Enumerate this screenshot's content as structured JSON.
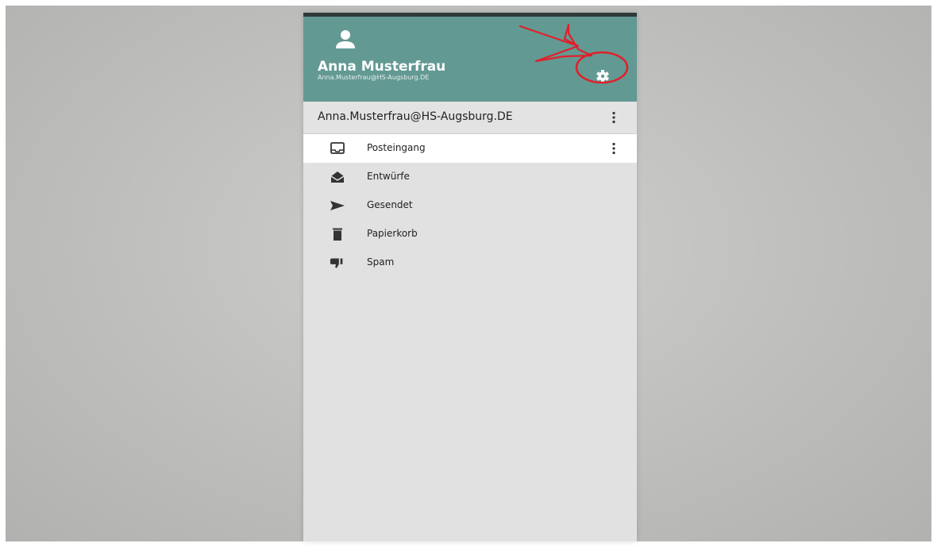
{
  "user": {
    "name": "Anna Musterfrau",
    "email": "Anna.Musterfrau@HS-Augsburg.DE"
  },
  "account": {
    "label": "Anna.Musterfrau@HS-Augsburg.DE"
  },
  "folders": [
    {
      "label": "Posteingang",
      "icon": "inbox-icon",
      "active": true
    },
    {
      "label": "Entwürfe",
      "icon": "envelope-open-icon",
      "active": false
    },
    {
      "label": "Gesendet",
      "icon": "send-icon",
      "active": false
    },
    {
      "label": "Papierkorb",
      "icon": "trash-icon",
      "active": false
    },
    {
      "label": "Spam",
      "icon": "thumbs-down-icon",
      "active": false
    }
  ],
  "colors": {
    "header": "#639993",
    "annotation": "#e0202a",
    "sidebar": "#e1e1e1"
  }
}
